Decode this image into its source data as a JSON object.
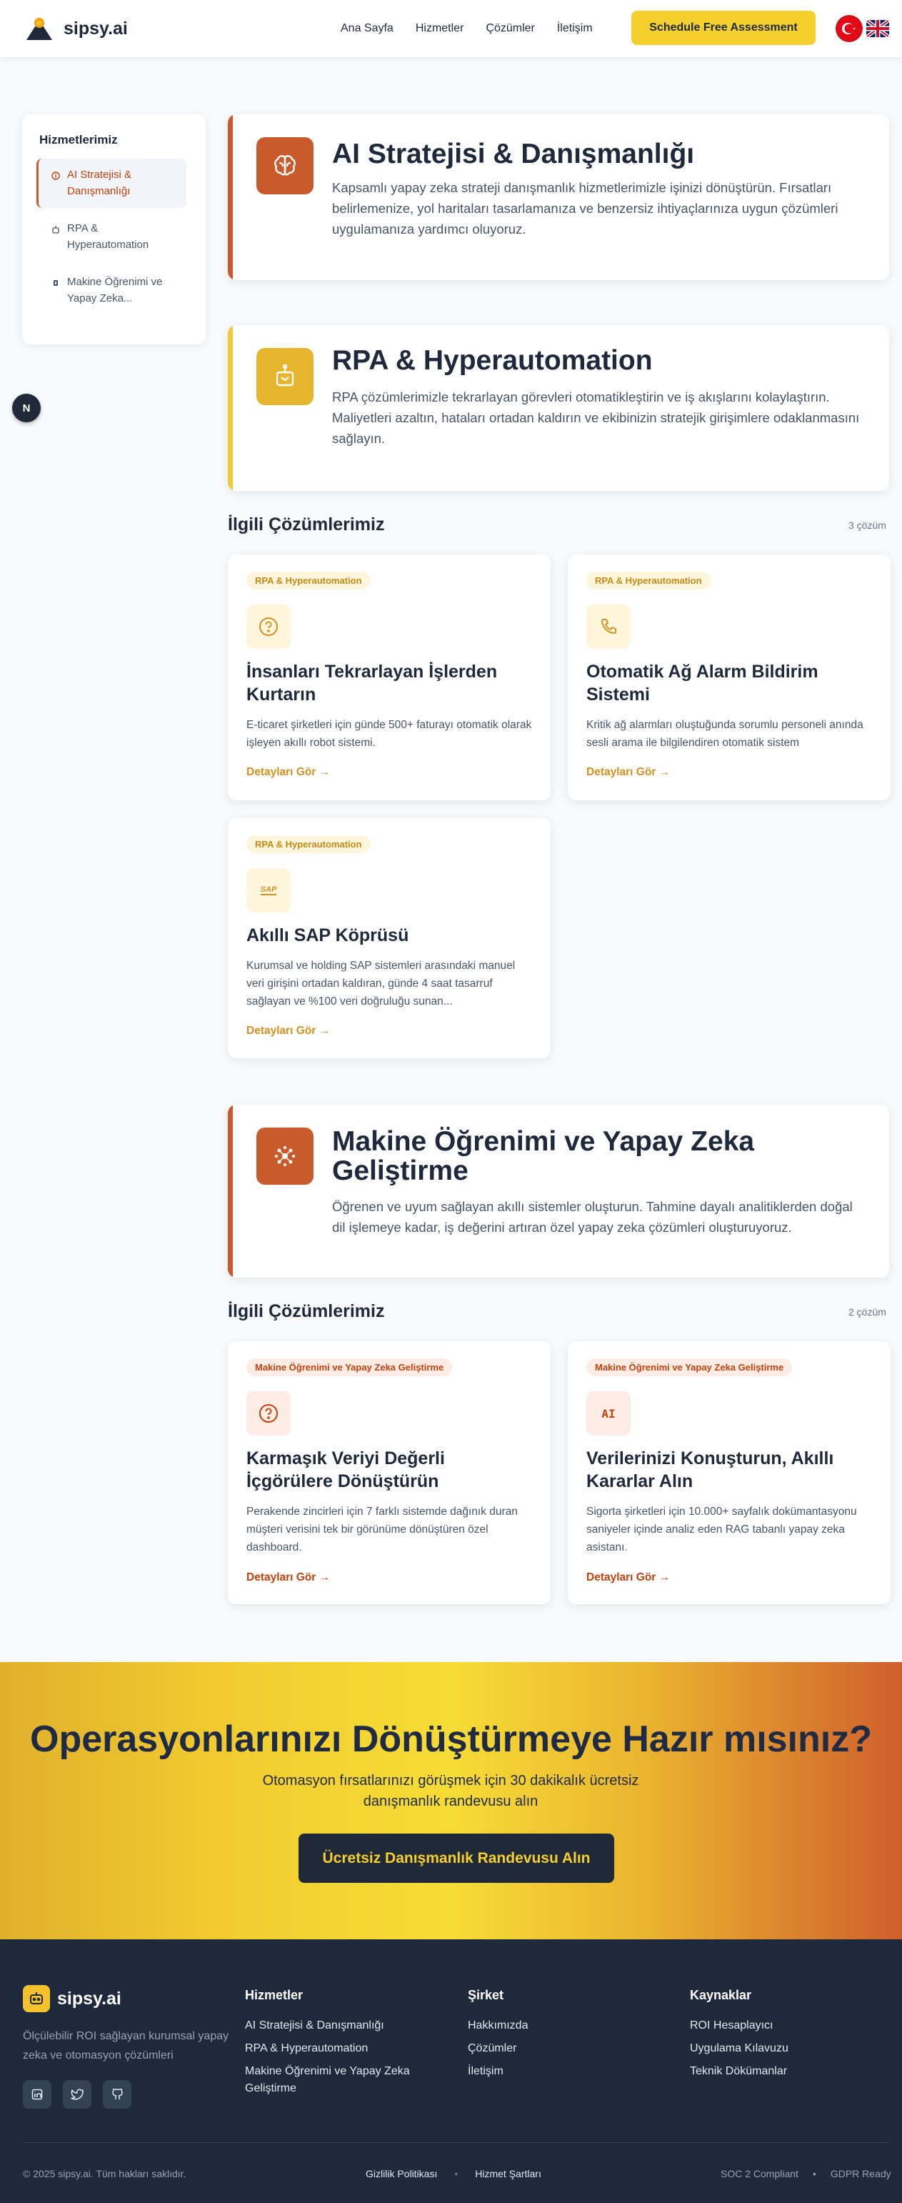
{
  "header": {
    "logo_text": "sipsy.ai",
    "nav": [
      "Ana Sayfa",
      "Hizmetler",
      "Çözümler",
      "İletişim"
    ],
    "cta": "Schedule Free Assessment",
    "languages": [
      "tr-flag",
      "uk-flag"
    ]
  },
  "sidebar": {
    "title": "Hizmetlerimiz",
    "items": [
      {
        "label": "AI Stratejisi & Danışmanlığı",
        "icon": "brain-icon",
        "active": true
      },
      {
        "label": "RPA & Hyperautomation",
        "icon": "robot-icon",
        "active": false
      },
      {
        "label": "Makine Öğrenimi ve Yapay Zeka...",
        "icon": "chip-icon",
        "active": false
      }
    ]
  },
  "chat_button": "N",
  "services": [
    {
      "title": "AI Stratejisi & Danışmanlığı",
      "description": "Kapsamlı yapay zeka strateji danışmanlık hizmetlerimizle işinizi dönüştürün. Fırsatları belirlemenize, yol haritaları tasarlamanıza ve benzersiz ihtiyaçlarınıza uygun çözümleri uygulamanıza yardımcı oluyoruz.",
      "icon": "brain-icon",
      "color": "#c85a2b"
    },
    {
      "title": "RPA & Hyperautomation",
      "description": "RPA çözümlerimizle tekrarlayan görevleri otomatikleştirin ve iş akışlarını kolaylaştırın. Maliyetleri azaltın, hataları ortadan kaldırın ve ekibinizin stratejik girişimlere odaklanmasını sağlayın.",
      "icon": "robot-icon",
      "color": "#f0c93a"
    },
    {
      "title": "Makine Öğrenimi ve Yapay Zeka Geliştirme",
      "description": "Öğrenen ve uyum sağlayan akıllı sistemler oluşturun. Tahmine dayalı analitiklerden doğal dil işlemeye kadar, iş değerini artıran özel yapay zeka çözümleri oluşturuyoruz.",
      "icon": "chip-icon",
      "color": "#c85a2b"
    }
  ],
  "related": [
    {
      "heading": "İlgili Çözümlerimiz",
      "count": "3 çözüm",
      "cards": [
        {
          "badge": "RPA & Hyperautomation",
          "icon": "question-icon",
          "title": "İnsanları Tekrarlayan İşlerden Kurtarın",
          "description": "E-ticaret şirketleri için günde 500+ faturayı otomatik olarak işleyen akıllı robot sistemi.",
          "link": "Detayları Gör →"
        },
        {
          "badge": "RPA & Hyperautomation",
          "icon": "phone-icon",
          "title": "Otomatik Ağ Alarm Bildirim Sistemi",
          "description": "Kritik ağ alarmları oluştuğunda sorumlu personeli anında sesli arama ile bilgilendiren otomatik sistem",
          "link": "Detayları Gör →"
        },
        {
          "badge": "RPA & Hyperautomation",
          "icon": "sap-icon",
          "icon_text": "SAP",
          "title": "Akıllı SAP Köprüsü",
          "description": "Kurumsal ve holding SAP sistemleri arasındaki manuel veri girişini ortadan kaldıran, günde 4 saat tasarruf sağlayan ve %100 veri doğruluğu sunan...",
          "link": "Detayları Gör →"
        }
      ]
    },
    {
      "heading": "İlgili Çözümlerimiz",
      "count": "2 çözüm",
      "cards": [
        {
          "badge": "Makine Öğrenimi ve Yapay Zeka Geliştirme",
          "icon": "question-icon",
          "title": "Karmaşık Veriyi Değerli İçgörülere Dönüştürün",
          "description": "Perakende zincirleri için 7 farklı sistemde dağınık duran müşteri verisini tek bir görünüme dönüştüren özel dashboard.",
          "link": "Detayları Gör →"
        },
        {
          "badge": "Makine Öğrenimi ve Yapay Zeka Geliştirme",
          "icon": "ai-icon",
          "icon_text": "AI",
          "title": "Verilerinizi Konuşturun, Akıllı Kararlar Alın",
          "description": "Sigorta şirketleri için 10.000+ sayfalık dokümantasyonu saniyeler içinde analiz eden RAG tabanlı yapay zeka asistanı.",
          "link": "Detayları Gör →"
        }
      ]
    }
  ],
  "cta_band": {
    "title": "Operasyonlarınızı Dönüştürmeye Hazır mısınız?",
    "subtitle": "Otomasyon fırsatlarınızı görüşmek için 30 dakikalık ücretsiz danışmanlık randevusu alın",
    "button": "Ücretsiz Danışmanlık Randevusu Alın"
  },
  "footer": {
    "logo_text": "sipsy.ai",
    "tagline": "Ölçülebilir ROI sağlayan kurumsal yapay zeka ve otomasyon çözümleri",
    "social": [
      "linkedin-icon",
      "twitter-icon",
      "github-icon"
    ],
    "columns": [
      {
        "title": "Hizmetler",
        "links": [
          "AI Stratejisi & Danışmanlığı",
          "RPA & Hyperautomation",
          "Makine Öğrenimi ve Yapay Zeka Geliştirme"
        ]
      },
      {
        "title": "Şirket",
        "links": [
          "Hakkımızda",
          "Çözümler",
          "İletişim"
        ]
      },
      {
        "title": "Kaynaklar",
        "links": [
          "ROI Hesaplayıcı",
          "Uygulama Kılavuzu",
          "Teknik Dökümanlar"
        ]
      }
    ],
    "copyright": "© 2025 sipsy.ai. Tüm hakları saklıdır.",
    "legal": [
      "Gizlilik Politikası",
      "Hizmet Şartları"
    ],
    "badges": [
      "SOC 2 Compliant",
      "GDPR Ready"
    ]
  }
}
